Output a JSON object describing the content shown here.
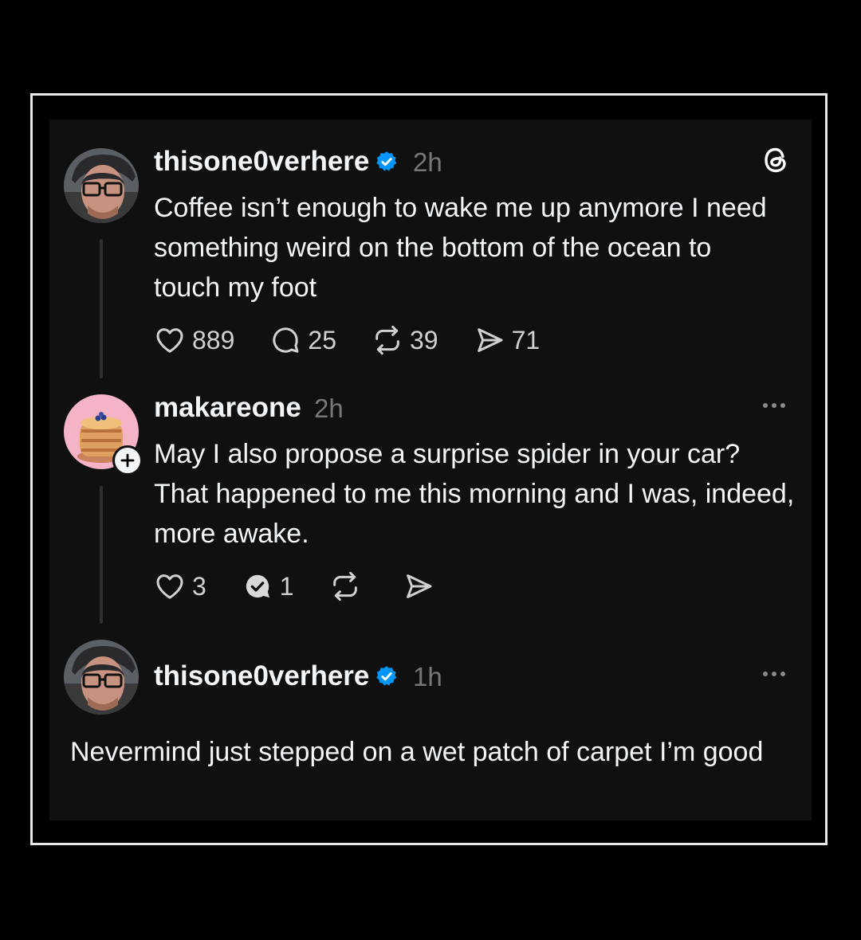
{
  "posts": [
    {
      "username": "thisone0verhere",
      "verified": true,
      "time": "2h",
      "text": "Coffee isn’t enough to wake me up anymore I need something weird on the bottom of the ocean to touch my foot",
      "likes": "889",
      "replies": "25",
      "reposts": "39",
      "shares": "71"
    },
    {
      "username": "makareone",
      "verified": false,
      "time": "2h",
      "text": "May I also propose a surprise spider in your car? That happened to me this morning and I was, indeed, more awake.",
      "likes": "3",
      "replies": "1"
    },
    {
      "username": "thisone0verhere",
      "verified": true,
      "time": "1h",
      "text": "Nevermind just stepped on a wet patch of carpet I’m good"
    }
  ],
  "icons": {
    "app_logo": "threads-logo",
    "like": "heart-icon",
    "reply": "comment-icon",
    "repost": "repost-icon",
    "share": "send-icon",
    "more": "more-dots-icon",
    "follow": "plus-icon",
    "verified": "verified-badge-icon"
  },
  "colors": {
    "background": "#000000",
    "card": "#101010",
    "text": "#f3f5f7",
    "muted": "#777777",
    "verified": "#0095f6"
  }
}
